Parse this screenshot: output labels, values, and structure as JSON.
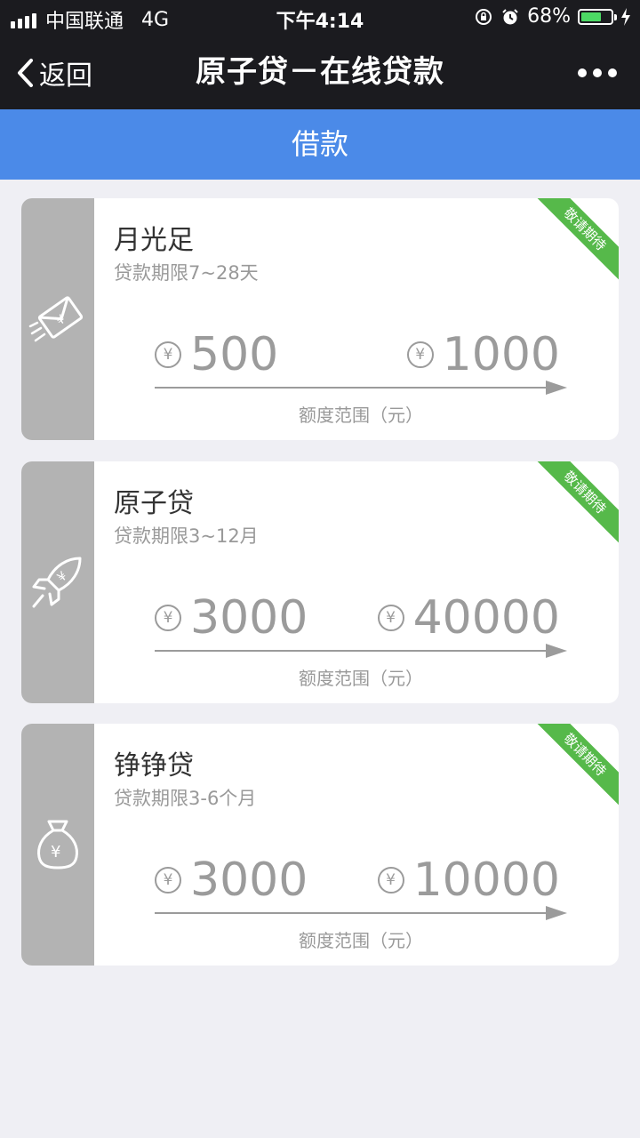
{
  "status_bar": {
    "carrier": "中国联通",
    "network": "4G",
    "time": "下午4:14",
    "battery_percent": "68%",
    "battery_level": 0.68
  },
  "nav": {
    "back_label": "返回",
    "title": "原子贷－在线贷款"
  },
  "section": {
    "title": "借款"
  },
  "products": [
    {
      "name": "月光足",
      "term": "贷款期限7~28天",
      "min": "500",
      "max": "1000",
      "range_label": "额度范围（元）",
      "ribbon": "敬请期待",
      "icon": "envelope-yen-icon"
    },
    {
      "name": "原子贷",
      "term": "贷款期限3~12月",
      "min": "3000",
      "max": "40000",
      "range_label": "额度范围（元）",
      "ribbon": "敬请期待",
      "icon": "rocket-yen-icon"
    },
    {
      "name": "铮铮贷",
      "term": "贷款期限3-6个月",
      "min": "3000",
      "max": "10000",
      "range_label": "额度范围（元）",
      "ribbon": "敬请期待",
      "icon": "money-bag-yen-icon"
    }
  ],
  "currency_symbol": "¥",
  "colors": {
    "nav_background": "#1b1b1f",
    "section_header": "#4b8ae8",
    "ribbon": "#56b94a",
    "battery": "#4cd964"
  }
}
